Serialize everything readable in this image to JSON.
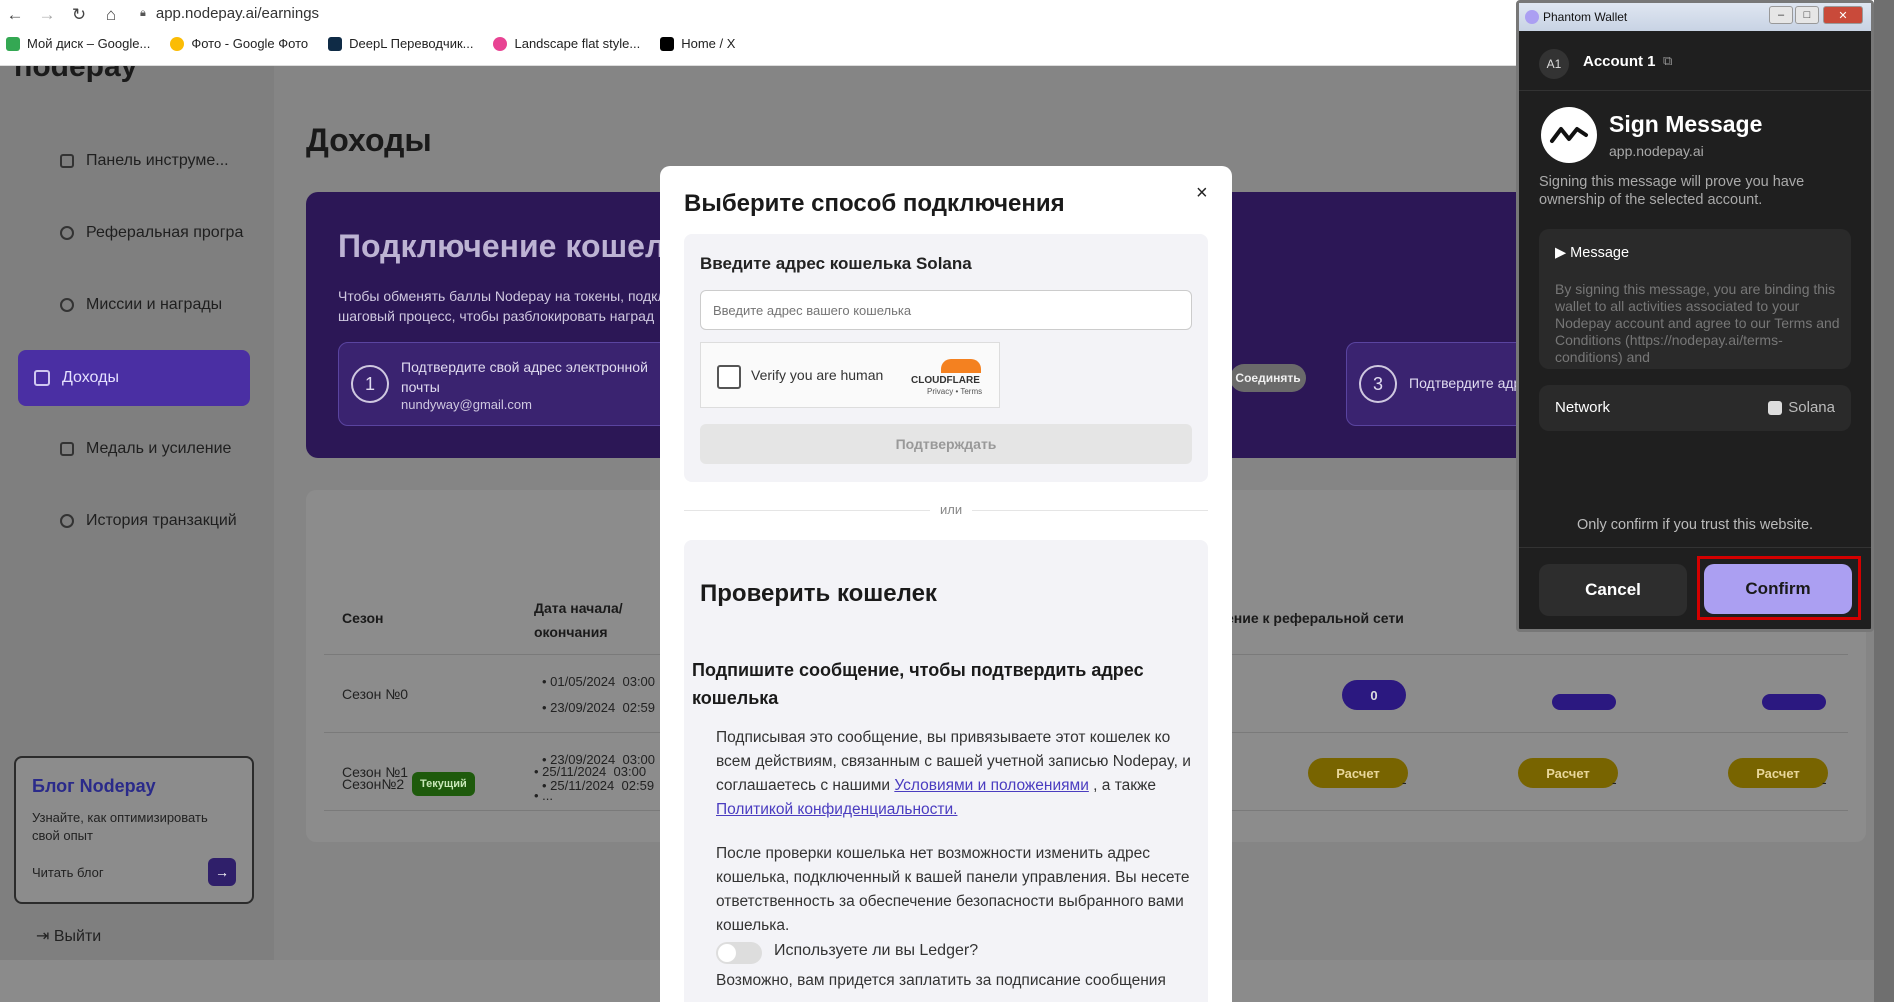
{
  "browser": {
    "url": "app.nodepay.ai/earnings",
    "bookmarks": [
      {
        "label": "Мой диск – Google...",
        "color": "#34a853"
      },
      {
        "label": "Фото - Google Фото",
        "color": "#fbbc05"
      },
      {
        "label": "DeepL Переводчик...",
        "color": "#0f2b46"
      },
      {
        "label": "Landscape flat style...",
        "color": "#e84393"
      },
      {
        "label": "Home / X",
        "color": "#000000"
      }
    ]
  },
  "sidebar": {
    "logo": "nodepay",
    "items": [
      {
        "label": "Панель инструме..."
      },
      {
        "label": "Реферальная програ"
      },
      {
        "label": "Миссии и награды"
      },
      {
        "label": "Доходы"
      },
      {
        "label": "Медаль и усиление"
      },
      {
        "label": "История транзакций"
      }
    ],
    "blog": {
      "title": "Блог Nodepay",
      "text": "Узнайте, как оптимизировать свой опыт",
      "link": "Читать блог"
    },
    "logout": "Выйти"
  },
  "main": {
    "title": "Доходы",
    "banner": {
      "title": "Подключение кошел",
      "text": "Чтобы обменять баллы Nodepay на токены, подкл шаговый процесс, чтобы разблокировать наград",
      "step1": {
        "num": "1",
        "text": "Подтвердите свой адрес электронной почты",
        "email": "nundyway@gmail.com"
      },
      "step3": {
        "num": "3",
        "text": "Подтвердите адр"
      },
      "connect": "Соединять"
    },
    "table": {
      "headers": {
        "season": "Сезон",
        "dates": "Дата начала/ окончания",
        "referral": "ение к реферальной сети"
      },
      "rows": [
        {
          "season": "Сезон №0",
          "start": "01/05/2024",
          "start_time": "03:00",
          "end": "23/09/2024",
          "end_time": "02:59",
          "value": "0"
        },
        {
          "season": "Сезон №1",
          "start": "23/09/2024",
          "start_time": "03:00",
          "end": "25/11/2024",
          "end_time": "02:59",
          "status": "Расчет"
        },
        {
          "season": "Сезон№2",
          "badge": "Текущий",
          "start": "25/11/2024",
          "start_time": "03:00",
          "end": "...",
          "dash": "-"
        }
      ]
    }
  },
  "modal": {
    "title": "Выберите способ подключения",
    "close": "×",
    "section1": {
      "title": "Введите адрес кошелька Solana",
      "placeholder": "Введите адрес вашего кошелька",
      "captcha": "Verify you are human",
      "cloudflare": "CLOUDFLARE",
      "cloudflare_links": "Privacy • Terms",
      "verify_button": "Подтверждать"
    },
    "or": "или",
    "section2": {
      "title": "Проверить кошелек",
      "subtitle": "Подпишите сообщение, чтобы подтвердить адрес кошелька",
      "para1_a": "Подписывая это сообщение, вы привязываете этот кошелек ко всем действиям, связанным с вашей учетной записью Nodepay, и соглашаетесь с нашими",
      "terms_link": "Условиями и положениями",
      "para1_b": ", а также",
      "privacy_link": "Политикой конфиденциальности.",
      "para2": "После проверки кошелька нет возможности изменить адрес кошелька, подключенный к вашей панели управления. Вы несете ответственность за обеспечение безопасности выбранного вами кошелька.",
      "ledger": "Используете ли вы Ledger?",
      "fee": "Возможно, вам придется заплатить за подписание сообщения"
    }
  },
  "phantom": {
    "window_title": "Phantom Wallet",
    "avatar": "A1",
    "account": "Account 1",
    "heading": "Sign Message",
    "domain": "app.nodepay.ai",
    "description": "Signing this message will prove you have ownership of the selected account.",
    "message_label": "▶ Message",
    "message_text": "By signing this message, you are binding this wallet to all activities associated to your Nodepay account and agree to our Terms and Conditions (https://nodepay.ai/terms-conditions) and",
    "network_label": "Network",
    "network_value": "Solana",
    "warning": "Only confirm if you trust this website.",
    "cancel": "Cancel",
    "confirm": "Confirm"
  }
}
